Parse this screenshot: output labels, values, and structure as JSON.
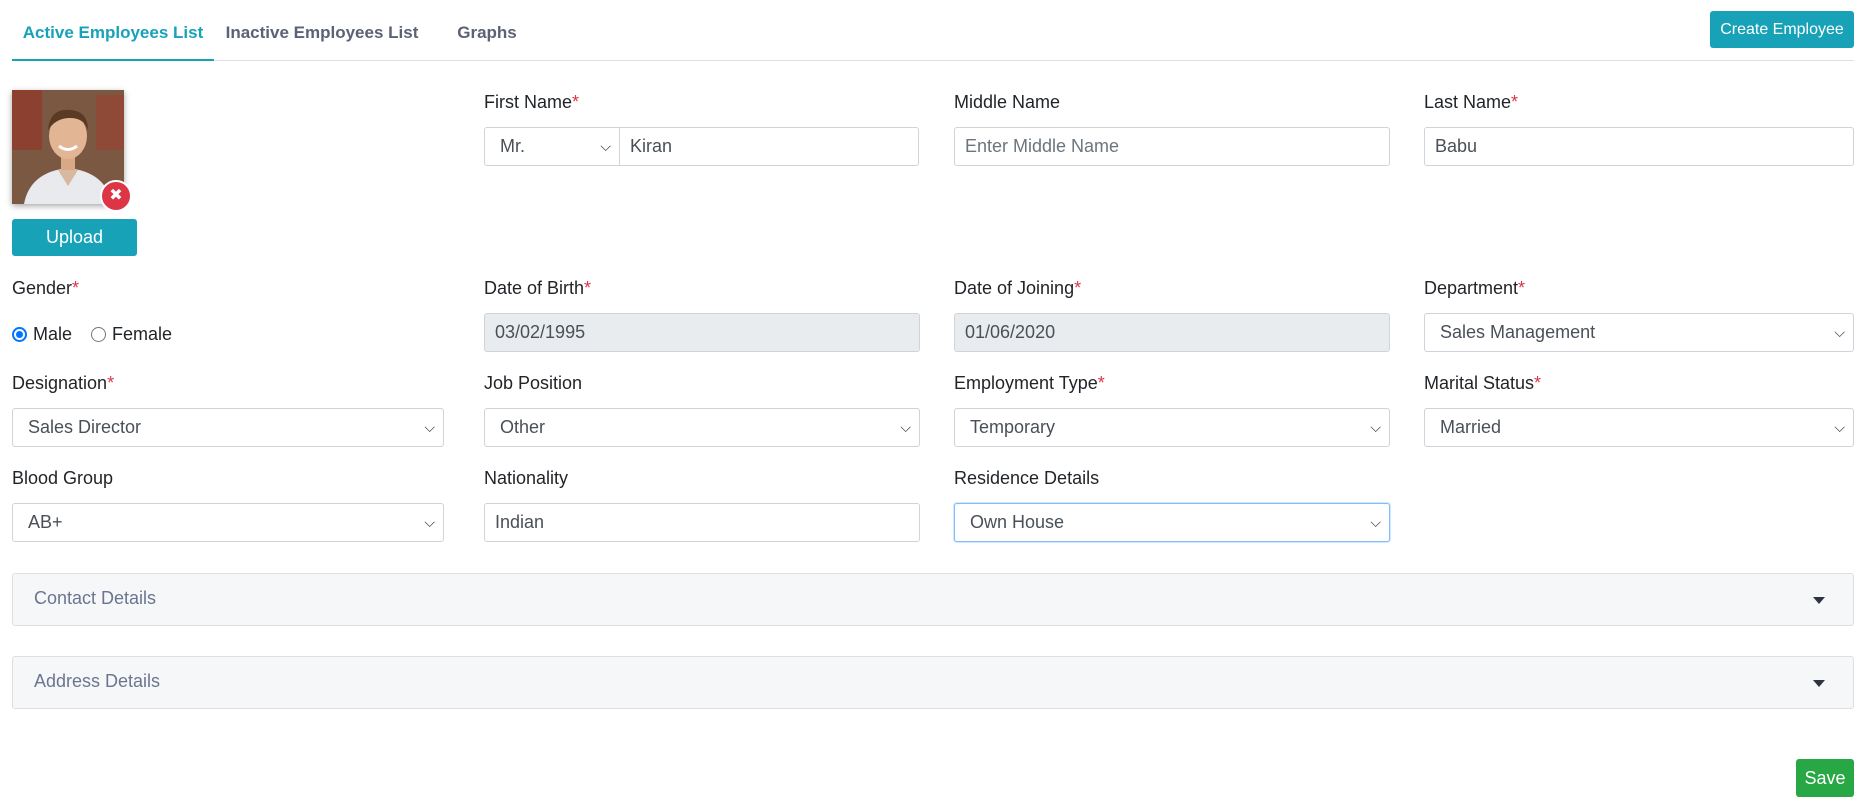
{
  "tabs": {
    "active": "Active Employees List",
    "inactive": "Inactive Employees List",
    "graphs": "Graphs"
  },
  "create_button": "Create Employee",
  "photo": {
    "upload_label": "Upload",
    "remove_icon": "times-circle-icon"
  },
  "required_marker": "*",
  "form": {
    "first_name": {
      "label": "First Name",
      "title": "Mr.",
      "value": "Kiran"
    },
    "middle_name": {
      "label": "Middle Name",
      "placeholder": "Enter Middle Name"
    },
    "last_name": {
      "label": "Last Name",
      "value": "Babu"
    },
    "gender": {
      "label": "Gender",
      "options": [
        "Male",
        "Female"
      ],
      "selected": "Male"
    },
    "dob": {
      "label": "Date of Birth",
      "value": "03/02/1995"
    },
    "doj": {
      "label": "Date of Joining",
      "value": "01/06/2020"
    },
    "department": {
      "label": "Department",
      "value": "Sales Management"
    },
    "designation": {
      "label": "Designation",
      "value": "Sales Director"
    },
    "job_position": {
      "label": "Job Position",
      "value": "Other"
    },
    "employment_type": {
      "label": "Employment Type",
      "value": "Temporary"
    },
    "marital_status": {
      "label": "Marital Status",
      "value": "Married"
    },
    "blood_group": {
      "label": "Blood Group",
      "value": "AB+"
    },
    "nationality": {
      "label": "Nationality",
      "value": "Indian"
    },
    "residence": {
      "label": "Residence Details",
      "value": "Own House"
    }
  },
  "sections": {
    "contact": "Contact Details",
    "address": "Address Details"
  },
  "save_button": "Save",
  "colors": {
    "accent": "#17a2b8",
    "required": "#dc3545",
    "save": "#28a745",
    "radio_checked": "#0075ff"
  }
}
